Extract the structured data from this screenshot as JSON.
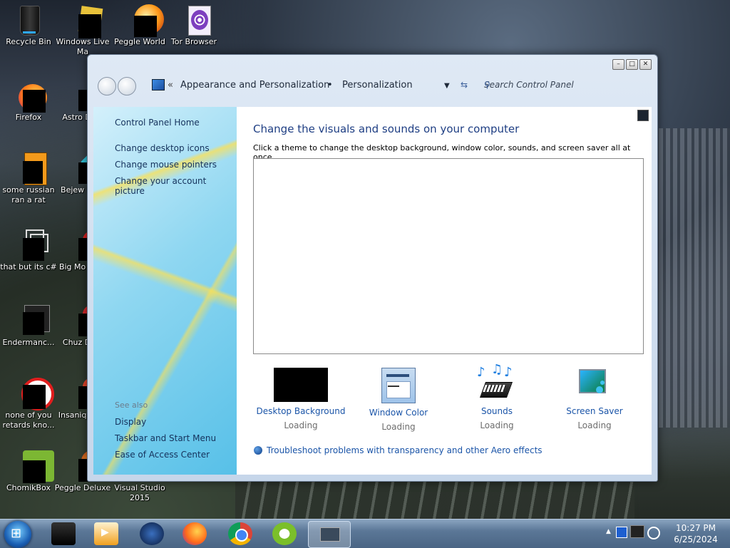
{
  "desktop": {
    "icons": [
      {
        "label": "Recycle Bin",
        "icon": "recycle-bin"
      },
      {
        "label": "Windows Live Ma",
        "icon": "windows-live"
      },
      {
        "label": "Peggle World",
        "icon": "peggle"
      },
      {
        "label": "Tor Browser",
        "icon": "tor"
      },
      {
        "label": "Firefox",
        "icon": "firefox"
      },
      {
        "label": "Astro Delu",
        "icon": "astro"
      },
      {
        "label": "some russian ran a rat",
        "icon": "orange-e"
      },
      {
        "label": "Bejew Delu",
        "icon": "bejeweled"
      },
      {
        "label": "that but its c#",
        "icon": "stack-pages"
      },
      {
        "label": "Big Mo Delu",
        "icon": "big-money"
      },
      {
        "label": "Endermanc...",
        "icon": "console"
      },
      {
        "label": "Chuz Delu",
        "icon": "chuzzle"
      },
      {
        "label": "none of you retards kno...",
        "icon": "red-circle"
      },
      {
        "label": "Insaniq Delu",
        "icon": "insaniquarium"
      },
      {
        "label": "ChomikBox",
        "icon": "chomikbox"
      },
      {
        "label": "Peggle Deluxe",
        "icon": "peggle-deluxe"
      },
      {
        "label": "Visual Studio 2015",
        "icon": "visual-studio"
      }
    ]
  },
  "window": {
    "controls": [
      "minimize",
      "maximize",
      "close"
    ],
    "breadcrumb": [
      "Appearance and Personalization",
      "Personalization"
    ],
    "search_placeholder": "Search Control Panel",
    "left_links": [
      "Control Panel Home",
      "Change desktop icons",
      "Change mouse pointers",
      "Change your account picture"
    ],
    "see_also_heading": "See also",
    "see_also_links": [
      "Display",
      "Taskbar and Start Menu",
      "Ease of Access Center"
    ],
    "heading": "Change the visuals and sounds on your computer",
    "subheading": "Click a theme to change the desktop background, window color, sounds, and screen saver all at once.",
    "tiles": [
      {
        "title": "Desktop Background",
        "status": "Loading"
      },
      {
        "title": "Window Color",
        "status": "Loading"
      },
      {
        "title": "Sounds",
        "status": "Loading"
      },
      {
        "title": "Screen Saver",
        "status": "Loading"
      }
    ],
    "troubleshoot_link": "Troubleshoot problems with transparency and other Aero effects"
  },
  "taskbar": {
    "pinned": [
      "terminal",
      "media-player",
      "browser-globe",
      "firefox",
      "chrome",
      "ccleaner",
      "control-panel-window"
    ],
    "time": "10:27 PM",
    "date": "6/25/2024"
  }
}
